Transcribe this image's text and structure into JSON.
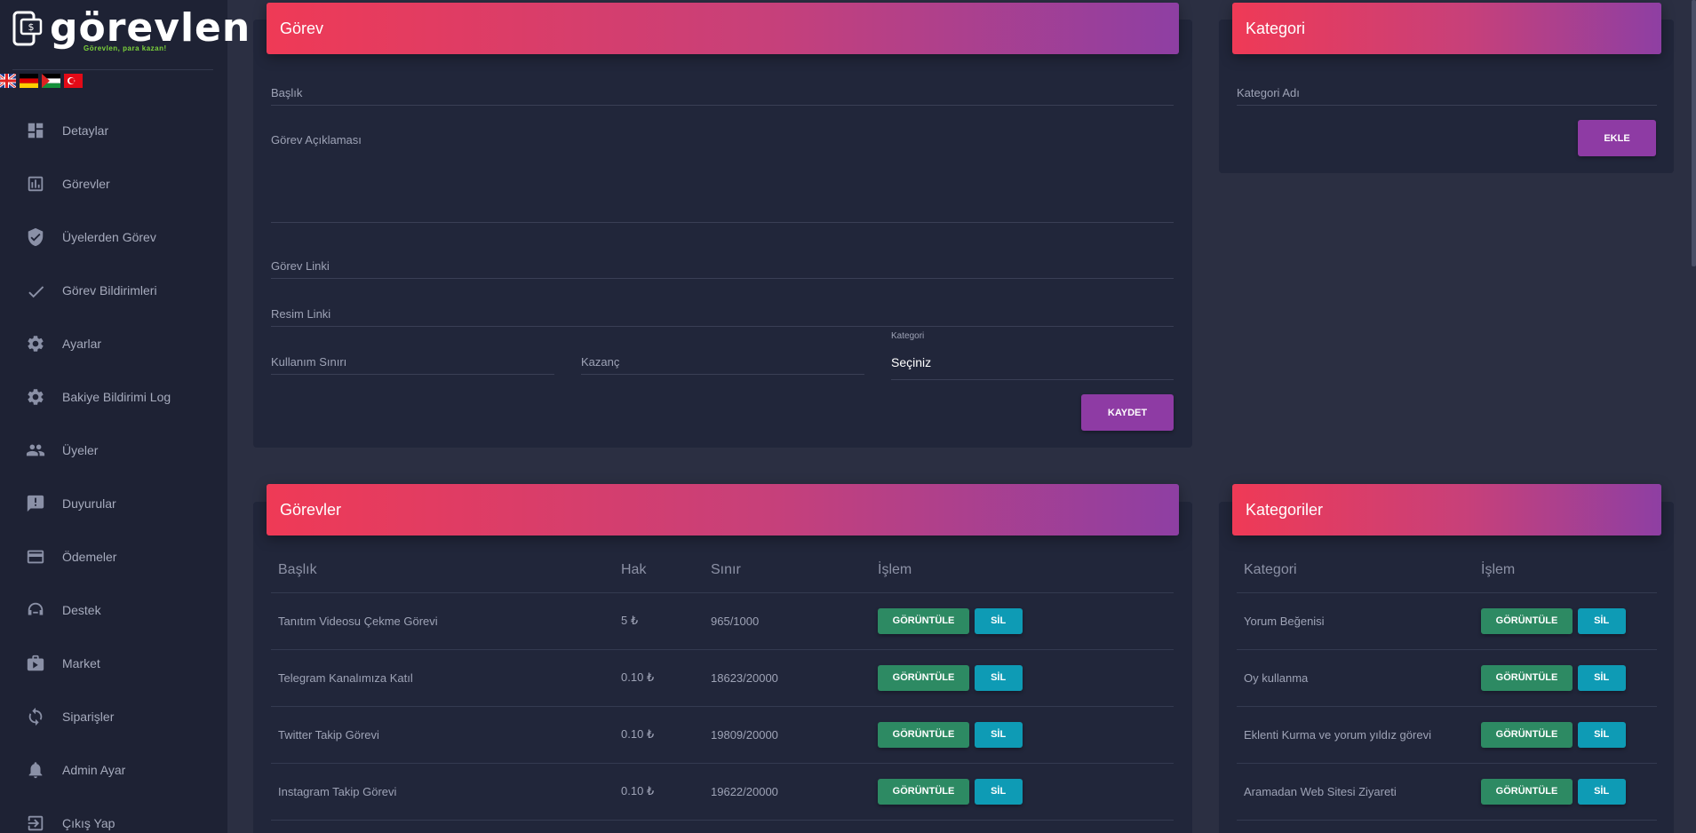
{
  "brand": {
    "name": "görevlen",
    "tagline": "Görevlen, para kazan!"
  },
  "flags": [
    "uk-flag-icon",
    "germany-flag-icon",
    "palestine-flag-icon",
    "turkey-flag-icon"
  ],
  "sidebar": {
    "items": [
      {
        "label": "Detaylar",
        "icon": "dashboard-icon"
      },
      {
        "label": "Görevler",
        "icon": "chart-icon"
      },
      {
        "label": "Üyelerden Görev",
        "icon": "shield-check-icon"
      },
      {
        "label": "Görev Bildirimleri",
        "icon": "check-icon"
      },
      {
        "label": "Ayarlar",
        "icon": "gear-icon"
      },
      {
        "label": "Bakiye Bildirimi Log",
        "icon": "gear-icon"
      },
      {
        "label": "Üyeler",
        "icon": "users-icon"
      },
      {
        "label": "Duyurular",
        "icon": "announcement-icon"
      },
      {
        "label": "Ödemeler",
        "icon": "credit-card-icon"
      },
      {
        "label": "Destek",
        "icon": "support-icon"
      },
      {
        "label": "Market",
        "icon": "shopping-bag-icon"
      },
      {
        "label": "Siparişler",
        "icon": "sync-icon"
      },
      {
        "label": "Admin Ayar",
        "icon": "bell-icon"
      },
      {
        "label": "Çıkış Yap",
        "icon": "logout-icon"
      }
    ]
  },
  "task_form": {
    "title": "Görev",
    "fields": {
      "title_label": "Başlık",
      "description_label": "Görev Açıklaması",
      "link_label": "Görev Linki",
      "image_label": "Resim Linki",
      "limit_label": "Kullanım Sınırı",
      "earning_label": "Kazanç",
      "category_label": "Kategori",
      "category_value": "Seçiniz"
    },
    "save_label": "KAYDET"
  },
  "category_form": {
    "title": "Kategori",
    "name_label": "Kategori Adı",
    "add_label": "EKLE"
  },
  "tasks_table": {
    "title": "Görevler",
    "headers": [
      "Başlık",
      "Hak",
      "Sınır",
      "İşlem"
    ],
    "view_label": "GÖRÜNTÜLE",
    "delete_label": "SİL",
    "rows": [
      {
        "title": "Tanıtım Videosu Çekme Görevi",
        "reward": "5 ₺",
        "limit": "965/1000"
      },
      {
        "title": "Telegram Kanalımıza Katıl",
        "reward": "0.10 ₺",
        "limit": "18623/20000"
      },
      {
        "title": "Twitter Takip Görevi",
        "reward": "0.10 ₺",
        "limit": "19809/20000"
      },
      {
        "title": "Instagram Takip Görevi",
        "reward": "0.10 ₺",
        "limit": "19622/20000"
      }
    ]
  },
  "categories_table": {
    "title": "Kategoriler",
    "headers": [
      "Kategori",
      "İşlem"
    ],
    "view_label": "GÖRÜNTÜLE",
    "delete_label": "SİL",
    "rows": [
      {
        "name": "Yorum Beğenisi"
      },
      {
        "name": "Oy kullanma"
      },
      {
        "name": "Eklenti Kurma ve yorum yıldız görevi"
      },
      {
        "name": "Aramadan Web Sitesi Ziyareti"
      }
    ]
  },
  "colors": {
    "sidebar_bg": "#1e2234",
    "page_bg": "#2b2f42",
    "card_bg": "#21263a",
    "header_gradient_start": "#ef3a56",
    "header_gradient_end": "#8e3fa3",
    "btn_purple": "#8e3ba4",
    "btn_green": "#2d8a63",
    "btn_teal": "#0e9bb5"
  }
}
